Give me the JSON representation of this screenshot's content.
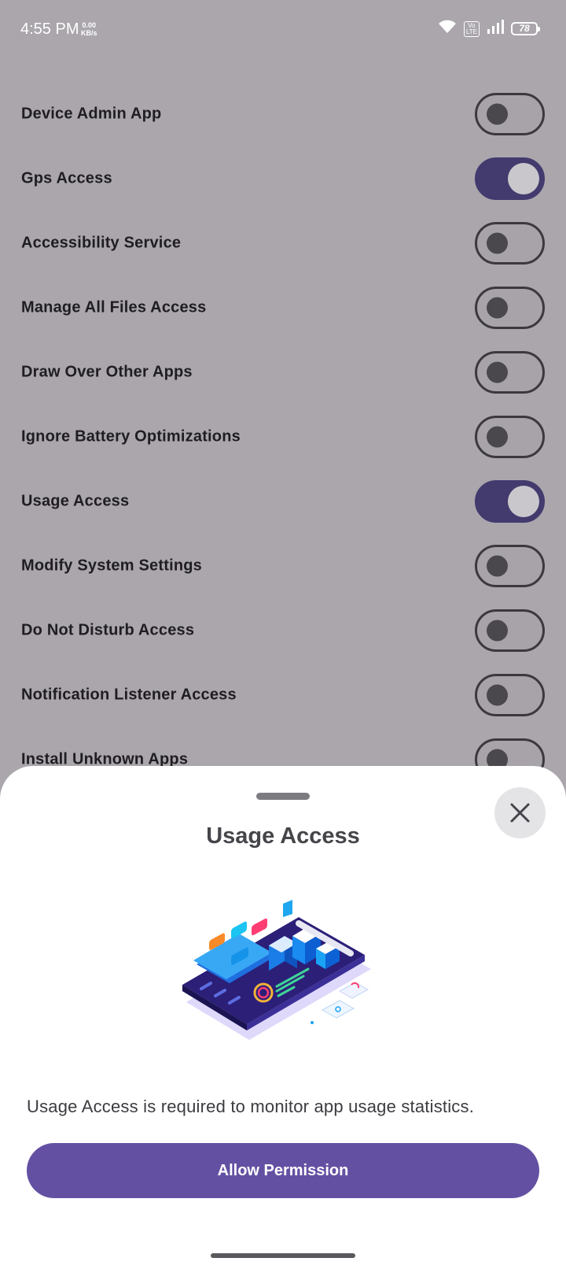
{
  "status_bar": {
    "time": "4:55 PM",
    "speed_value": "0.00",
    "speed_unit": "KB/s",
    "volte_top": "Vo",
    "volte_bottom": "LTE",
    "battery": "78"
  },
  "permissions": [
    {
      "label": "Device Admin App",
      "enabled": false
    },
    {
      "label": "Gps Access",
      "enabled": true
    },
    {
      "label": "Accessibility Service",
      "enabled": false
    },
    {
      "label": "Manage All Files Access",
      "enabled": false
    },
    {
      "label": "Draw Over Other Apps",
      "enabled": false
    },
    {
      "label": "Ignore Battery Optimizations",
      "enabled": false
    },
    {
      "label": "Usage Access",
      "enabled": true
    },
    {
      "label": "Modify System Settings",
      "enabled": false
    },
    {
      "label": "Do Not Disturb Access",
      "enabled": false
    },
    {
      "label": "Notification Listener Access",
      "enabled": false
    },
    {
      "label": "Install Unknown Apps",
      "enabled": false
    }
  ],
  "sheet": {
    "title": "Usage Access",
    "description": "Usage Access is required to monitor app usage statistics.",
    "button_label": "Allow Permission",
    "close_icon": "close-icon",
    "illustration": "phone-dashboard-illustration"
  },
  "colors": {
    "accent": "#6450a3",
    "toggle_on": "#433a6e",
    "scrim": "#aaa6ac"
  }
}
